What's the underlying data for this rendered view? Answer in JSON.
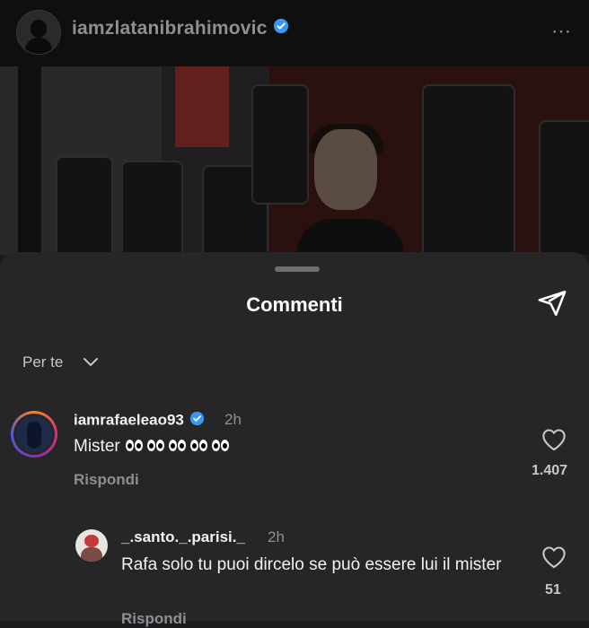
{
  "post": {
    "username": "iamzlatanibrahimovic",
    "more_icon": "⋯"
  },
  "sheet": {
    "title": "Commenti",
    "filter_label": "Per te"
  },
  "comments": [
    {
      "username": "iamrafaeleao93",
      "verified": true,
      "time": "2h",
      "text": "Mister",
      "reply_label": "Rispondi",
      "likes": "1.407"
    },
    {
      "username": "_.santo._.parisi._",
      "verified": false,
      "time": "2h",
      "text": "Rafa solo tu puoi dircelo se può essere lui il mister",
      "reply_label": "Rispondi",
      "likes": "51"
    }
  ],
  "colors": {
    "accent_verified": "#3897f0",
    "sheet_bg": "#262626",
    "muted_text": "#8e8e93"
  }
}
